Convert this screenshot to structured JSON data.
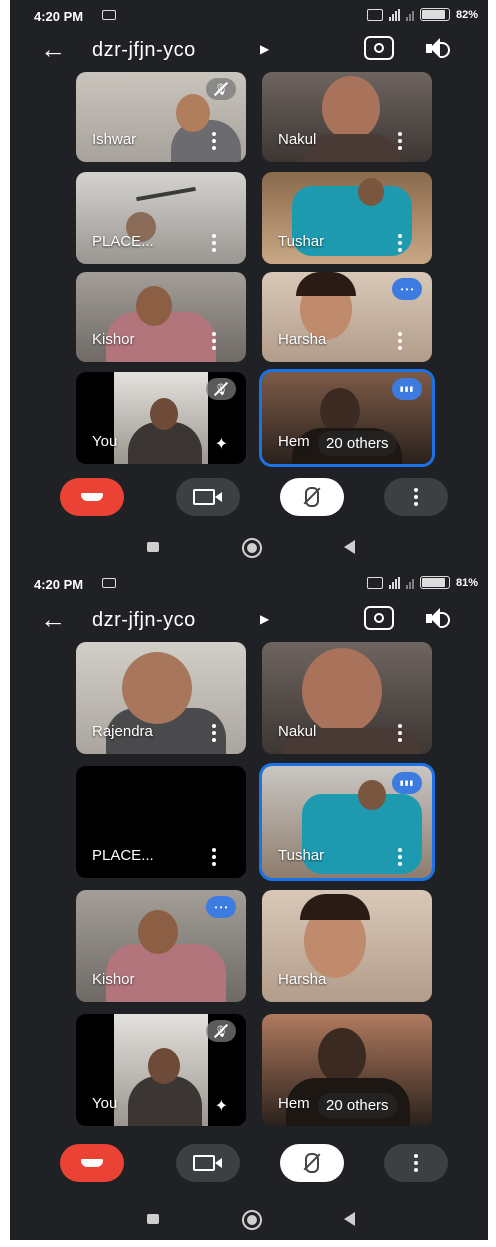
{
  "screens": [
    {
      "status": {
        "time": "4:20 PM",
        "battery": "82%",
        "battery_level": 0.82
      },
      "meeting_code": "dzr-jfjn-yco",
      "tiles": [
        {
          "name": "Ishwar",
          "badge": "muted"
        },
        {
          "name": "Nakul",
          "badge": ""
        },
        {
          "name": "PLACE...",
          "badge": ""
        },
        {
          "name": "Tushar",
          "badge": ""
        },
        {
          "name": "Kishor",
          "badge": ""
        },
        {
          "name": "Harsha",
          "badge": "dots"
        },
        {
          "name": "You",
          "badge": "muted"
        },
        {
          "name": "Hem",
          "badge": "talk",
          "others_label": "20 others"
        }
      ]
    },
    {
      "status": {
        "time": "4:20 PM",
        "battery": "81%",
        "battery_level": 0.81
      },
      "meeting_code": "dzr-jfjn-yco",
      "tiles": [
        {
          "name": "Rajendra",
          "badge": ""
        },
        {
          "name": "Nakul",
          "badge": ""
        },
        {
          "name": "PLACE...",
          "badge": ""
        },
        {
          "name": "Tushar",
          "badge": "talk"
        },
        {
          "name": "Kishor",
          "badge": "dots"
        },
        {
          "name": "Harsha",
          "badge": ""
        },
        {
          "name": "You",
          "badge": "muted"
        },
        {
          "name": "Hem",
          "badge": "",
          "others_label": "20 others"
        }
      ]
    }
  ],
  "icons": {
    "back": "arrow-left-icon",
    "switch_camera": "switch-camera-icon",
    "speaker": "speaker-icon",
    "end_call": "end-call-icon",
    "camera": "camera-icon",
    "mic_off": "mic-off-icon",
    "more": "more-vert-icon"
  },
  "colors": {
    "background": "#202124",
    "end_call": "#ea4335",
    "active_border": "#1a73e8",
    "badge_blue": "#3c7ce0"
  }
}
